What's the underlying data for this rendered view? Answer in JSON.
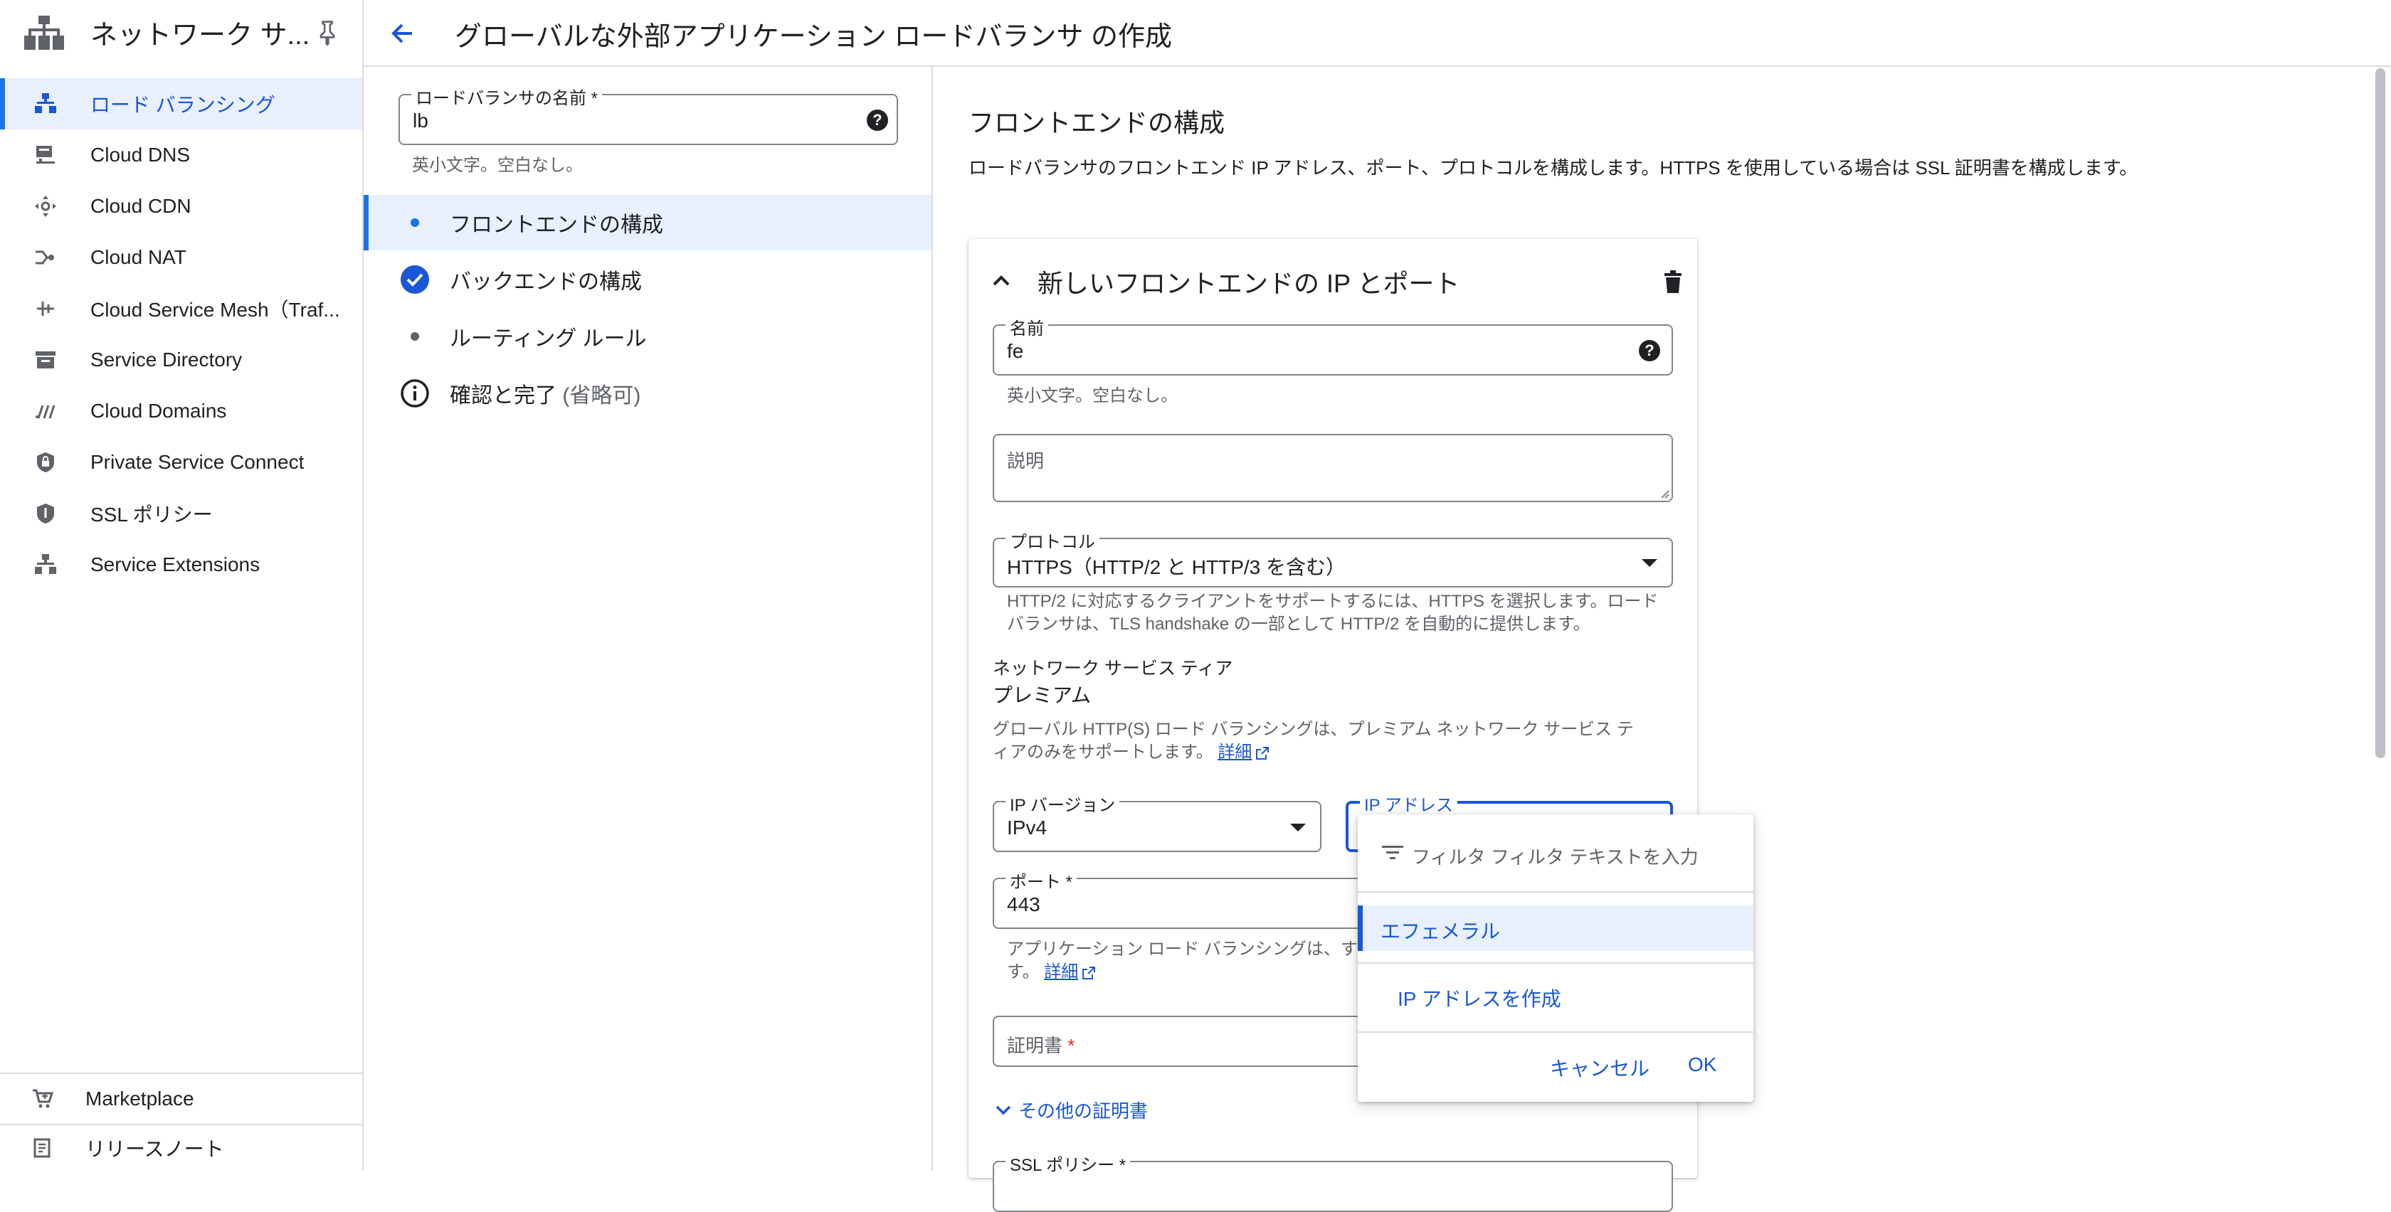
{
  "nav": {
    "title": "ネットワーク サ...",
    "items": [
      {
        "label": "ロード バランシング",
        "icon": "load-balancing-icon",
        "active": true
      },
      {
        "label": "Cloud DNS",
        "icon": "dns-icon"
      },
      {
        "label": "Cloud CDN",
        "icon": "cdn-icon"
      },
      {
        "label": "Cloud NAT",
        "icon": "nat-icon"
      },
      {
        "label": "Cloud Service Mesh（Traf...",
        "icon": "service-mesh-icon"
      },
      {
        "label": "Service Directory",
        "icon": "service-directory-icon"
      },
      {
        "label": "Cloud Domains",
        "icon": "domains-icon"
      },
      {
        "label": "Private Service Connect",
        "icon": "private-service-connect-icon"
      },
      {
        "label": "SSL ポリシー",
        "icon": "ssl-policy-icon"
      },
      {
        "label": "Service Extensions",
        "icon": "service-extensions-icon"
      }
    ],
    "bottom": [
      {
        "label": "Marketplace",
        "icon": "marketplace-icon"
      },
      {
        "label": "リリースノート",
        "icon": "release-notes-icon"
      }
    ]
  },
  "header": {
    "title": "グローバルな外部アプリケーション ロードバランサ の作成"
  },
  "steps_panel": {
    "lb_name_label": "ロードバランサの名前 *",
    "lb_name_value": "lb",
    "lb_name_hint": "英小文字。空白なし。",
    "steps": [
      {
        "label": "フロントエンドの構成",
        "state": "current"
      },
      {
        "label": "バックエンドの構成",
        "state": "done"
      },
      {
        "label": "ルーティング ルール",
        "state": "pending"
      },
      {
        "label": "確認と完了",
        "optional": "(省略可)",
        "state": "info"
      }
    ]
  },
  "main": {
    "section_title": "フロントエンドの構成",
    "section_desc": "ロードバランサのフロントエンド IP アドレス、ポート、プロトコルを構成します。HTTPS を使用している場合は SSL 証明書を構成します。",
    "card_title": "新しいフロントエンドの IP とポート",
    "name_label": "名前",
    "name_value": "fe",
    "name_hint": "英小文字。空白なし。",
    "description_placeholder": "説明",
    "protocol_label": "プロトコル",
    "protocol_value": "HTTPS（HTTP/2 と HTTP/3 を含む）",
    "protocol_hint": "HTTP/2 に対応するクライアントをサポートするには、HTTPS を選択します。ロードバランサは、TLS handshake の一部として HTTP/2 を自動的に提供します。",
    "tier_label": "ネットワーク サービス ティア",
    "tier_value": "プレミアム",
    "tier_hint": "グローバル HTTP(S) ロード バランシングは、プレミアム ネットワーク サービス ティアのみをサポートします。",
    "details_link": "詳細",
    "ip_version_label": "IP バージョン",
    "ip_version_value": "IPv4",
    "ip_address_label": "IP アドレス",
    "port_label": "ポート *",
    "port_value": "443",
    "port_hint": "アプリケーション ロード バランシングは、す",
    "port_hint_tail": "す。",
    "certificate_label": "証明書",
    "other_certs_label": "その他の証明書",
    "ssl_policy_label": "SSL ポリシー *"
  },
  "popup": {
    "filter_placeholder": "フィルタ フィルタ テキストを入力",
    "option_selected": "エフェメラル",
    "create_ip": "IP アドレスを作成",
    "cancel": "キャンセル",
    "ok": "OK"
  },
  "colors": {
    "accent": "#1a73e8",
    "link": "#1a56d6",
    "active_bg": "#e8f0fe",
    "required": "#d93025"
  }
}
